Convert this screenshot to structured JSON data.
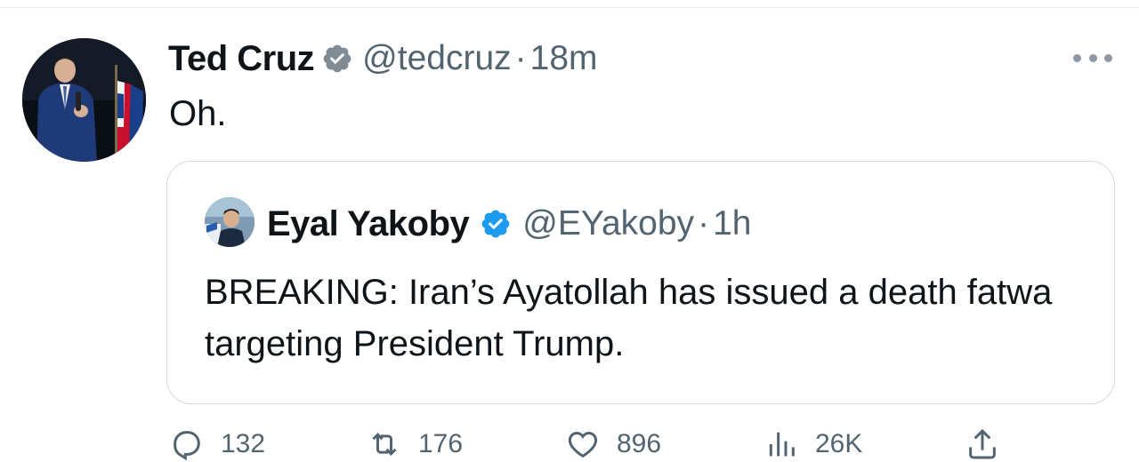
{
  "tweet": {
    "display_name": "Ted Cruz",
    "handle": "@tedcruz",
    "separator": "·",
    "time": "18m",
    "text": "Oh.",
    "avatar_icon": "profile-photo",
    "verified_icon": "verified-badge-icon",
    "verified_color": "#1d9bf0"
  },
  "quoted_tweet": {
    "display_name": "Eyal Yakoby",
    "handle": "@EYakoby",
    "separator": "·",
    "time": "1h",
    "text": "BREAKING: Iran’s Ayatollah has issued a death fatwa targeting President Trump."
  },
  "actions": {
    "replies": "132",
    "retweets": "176",
    "likes": "896",
    "views": "26K"
  },
  "colors": {
    "text_primary": "#0f1419",
    "text_secondary": "#536471",
    "border": "#cfd9de",
    "verified": "#1d9bf0"
  }
}
